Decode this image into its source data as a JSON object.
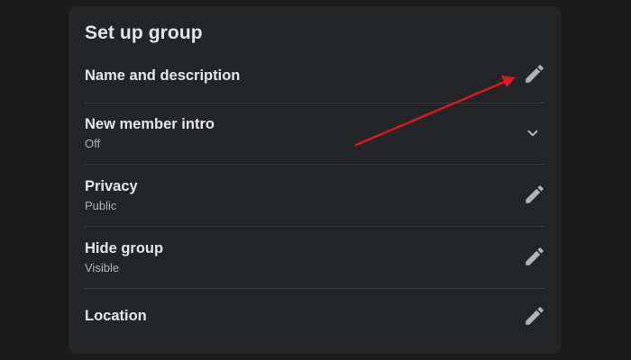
{
  "panel": {
    "title": "Set up group"
  },
  "rows": [
    {
      "label": "Name and description",
      "sub": "",
      "action_icon": "pencil-icon"
    },
    {
      "label": "New member intro",
      "sub": "Off",
      "action_icon": "chevron-down-icon"
    },
    {
      "label": "Privacy",
      "sub": "Public",
      "action_icon": "pencil-icon"
    },
    {
      "label": "Hide group",
      "sub": "Visible",
      "action_icon": "pencil-icon"
    },
    {
      "label": "Location",
      "sub": "",
      "action_icon": "pencil-icon"
    }
  ],
  "colors": {
    "background": "#1b1b1c",
    "panel": "#242526",
    "primary_text": "#e4e6eb",
    "secondary_text": "#b0b3b8",
    "icon": "#b0b3b8",
    "divider": "#3a3b3c",
    "annotation_arrow": "#e0181b"
  }
}
